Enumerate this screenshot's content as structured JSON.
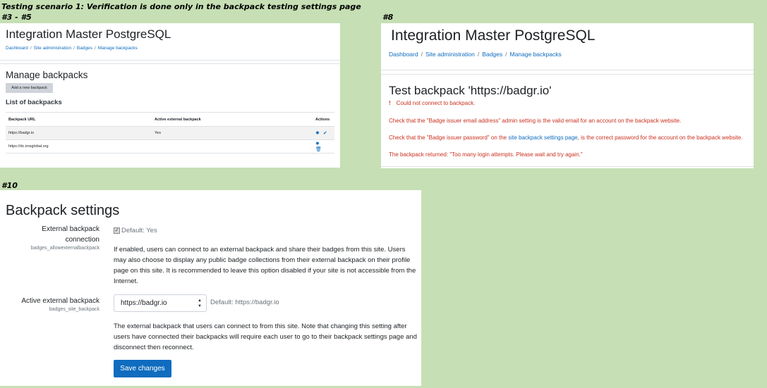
{
  "notes": {
    "scenario": "Testing scenario 1: Verification is done only in the backpack testing settings page",
    "step_a": "#3 - #5",
    "step_b": "#8",
    "step_c": "#10"
  },
  "site_name": "Integration Master PostgreSQL",
  "breadcrumb": [
    "Dashboard",
    "Site administration",
    "Badges",
    "Manage backpacks"
  ],
  "breadcrumb_sep": "/",
  "manage": {
    "title": "Manage backpacks",
    "add_button": "Add a new backpack",
    "list_title": "List of backpacks",
    "columns": [
      "Backpack URL",
      "Active external backpack",
      "Actions"
    ],
    "rows": [
      {
        "url": "https://badgr.io",
        "active": "Yes",
        "icons": [
          "gear-icon",
          "check-icon"
        ]
      },
      {
        "url": "https://dc.imsglobal.org",
        "active": "",
        "icons": [
          "gear-icon",
          "trash-icon"
        ]
      }
    ]
  },
  "test": {
    "title": "Test backpack 'https://badgr.io'",
    "error_head": "Could not connect to backpack.",
    "error_icon": "!",
    "line1": "Check that the \"Badge issuer email address\" admin setting is the valid email for an account on the backpack website.",
    "line2_pre": "Check that the \"Badge issuer password\" on the ",
    "line2_link": "site backpack settings page",
    "line2_post": ", is the correct password for the account on the backpack website.",
    "line3": "The backpack returned: \"Too many login attempts. Please wait and try again.\""
  },
  "settings": {
    "title": "Backpack settings",
    "external": {
      "label": "External backpack connection",
      "name": "badges_allowexternalbackpack",
      "checked": true,
      "default": "Default: Yes",
      "description": "If enabled, users can connect to an external backpack and share their badges from this site. Users may also choose to display any public badge collections from their external backpack on their profile page on this site. It is recommended to leave this option disabled if your site is not accessible from the Internet."
    },
    "active": {
      "label": "Active external backpack",
      "name": "badges_site_backpack",
      "selected": "https://badgr.io",
      "default": "Default: https://badgr.io",
      "description": "The external backpack that users can connect to from this site. Note that changing this setting after users have connected their backpacks will require each user to go to their backpack settings page and disconnect then reconnect."
    },
    "save": "Save changes"
  },
  "colors": {
    "background": "#c6dfb4",
    "accent": "#0f6cbf",
    "error": "#ca3120"
  }
}
